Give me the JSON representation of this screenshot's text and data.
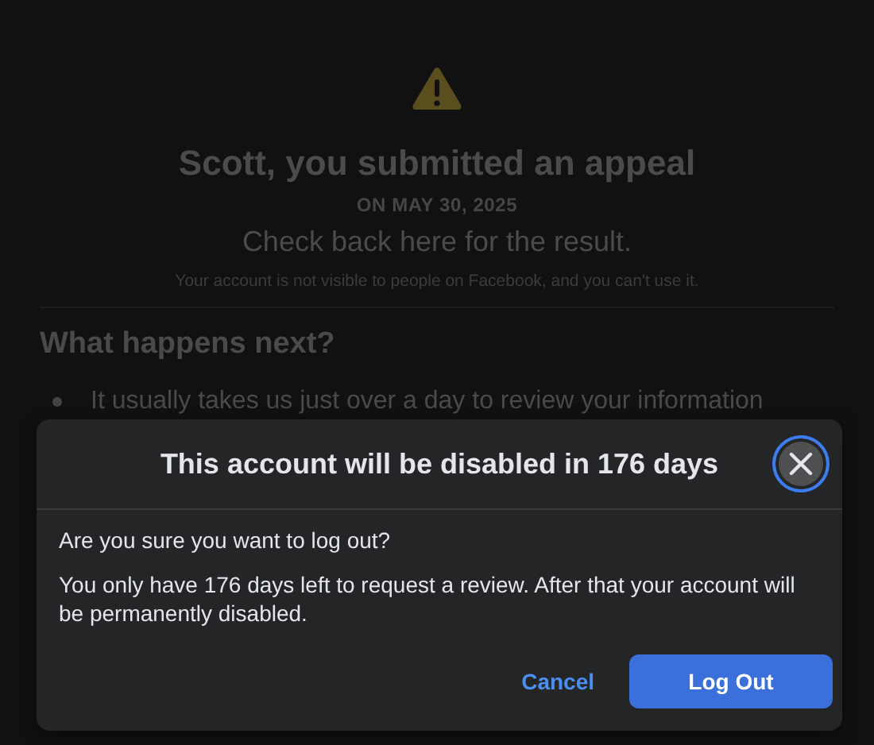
{
  "background": {
    "title": "Scott, you submitted an appeal",
    "date": "ON MAY 30, 2025",
    "subtitle": "Check back here for the result.",
    "note": "Your account is not visible to people on Facebook, and you can't use it.",
    "section_heading": "What happens next?",
    "bullets": [
      "It usually takes us just over a day to review your information"
    ]
  },
  "dialog": {
    "title": "This account will be disabled in 176 days",
    "question": "Are you sure you want to log out?",
    "message": "You only have 176 days left to request a review. After that your account will be permanently disabled.",
    "cancel": "Cancel",
    "confirm": "Log Out"
  }
}
